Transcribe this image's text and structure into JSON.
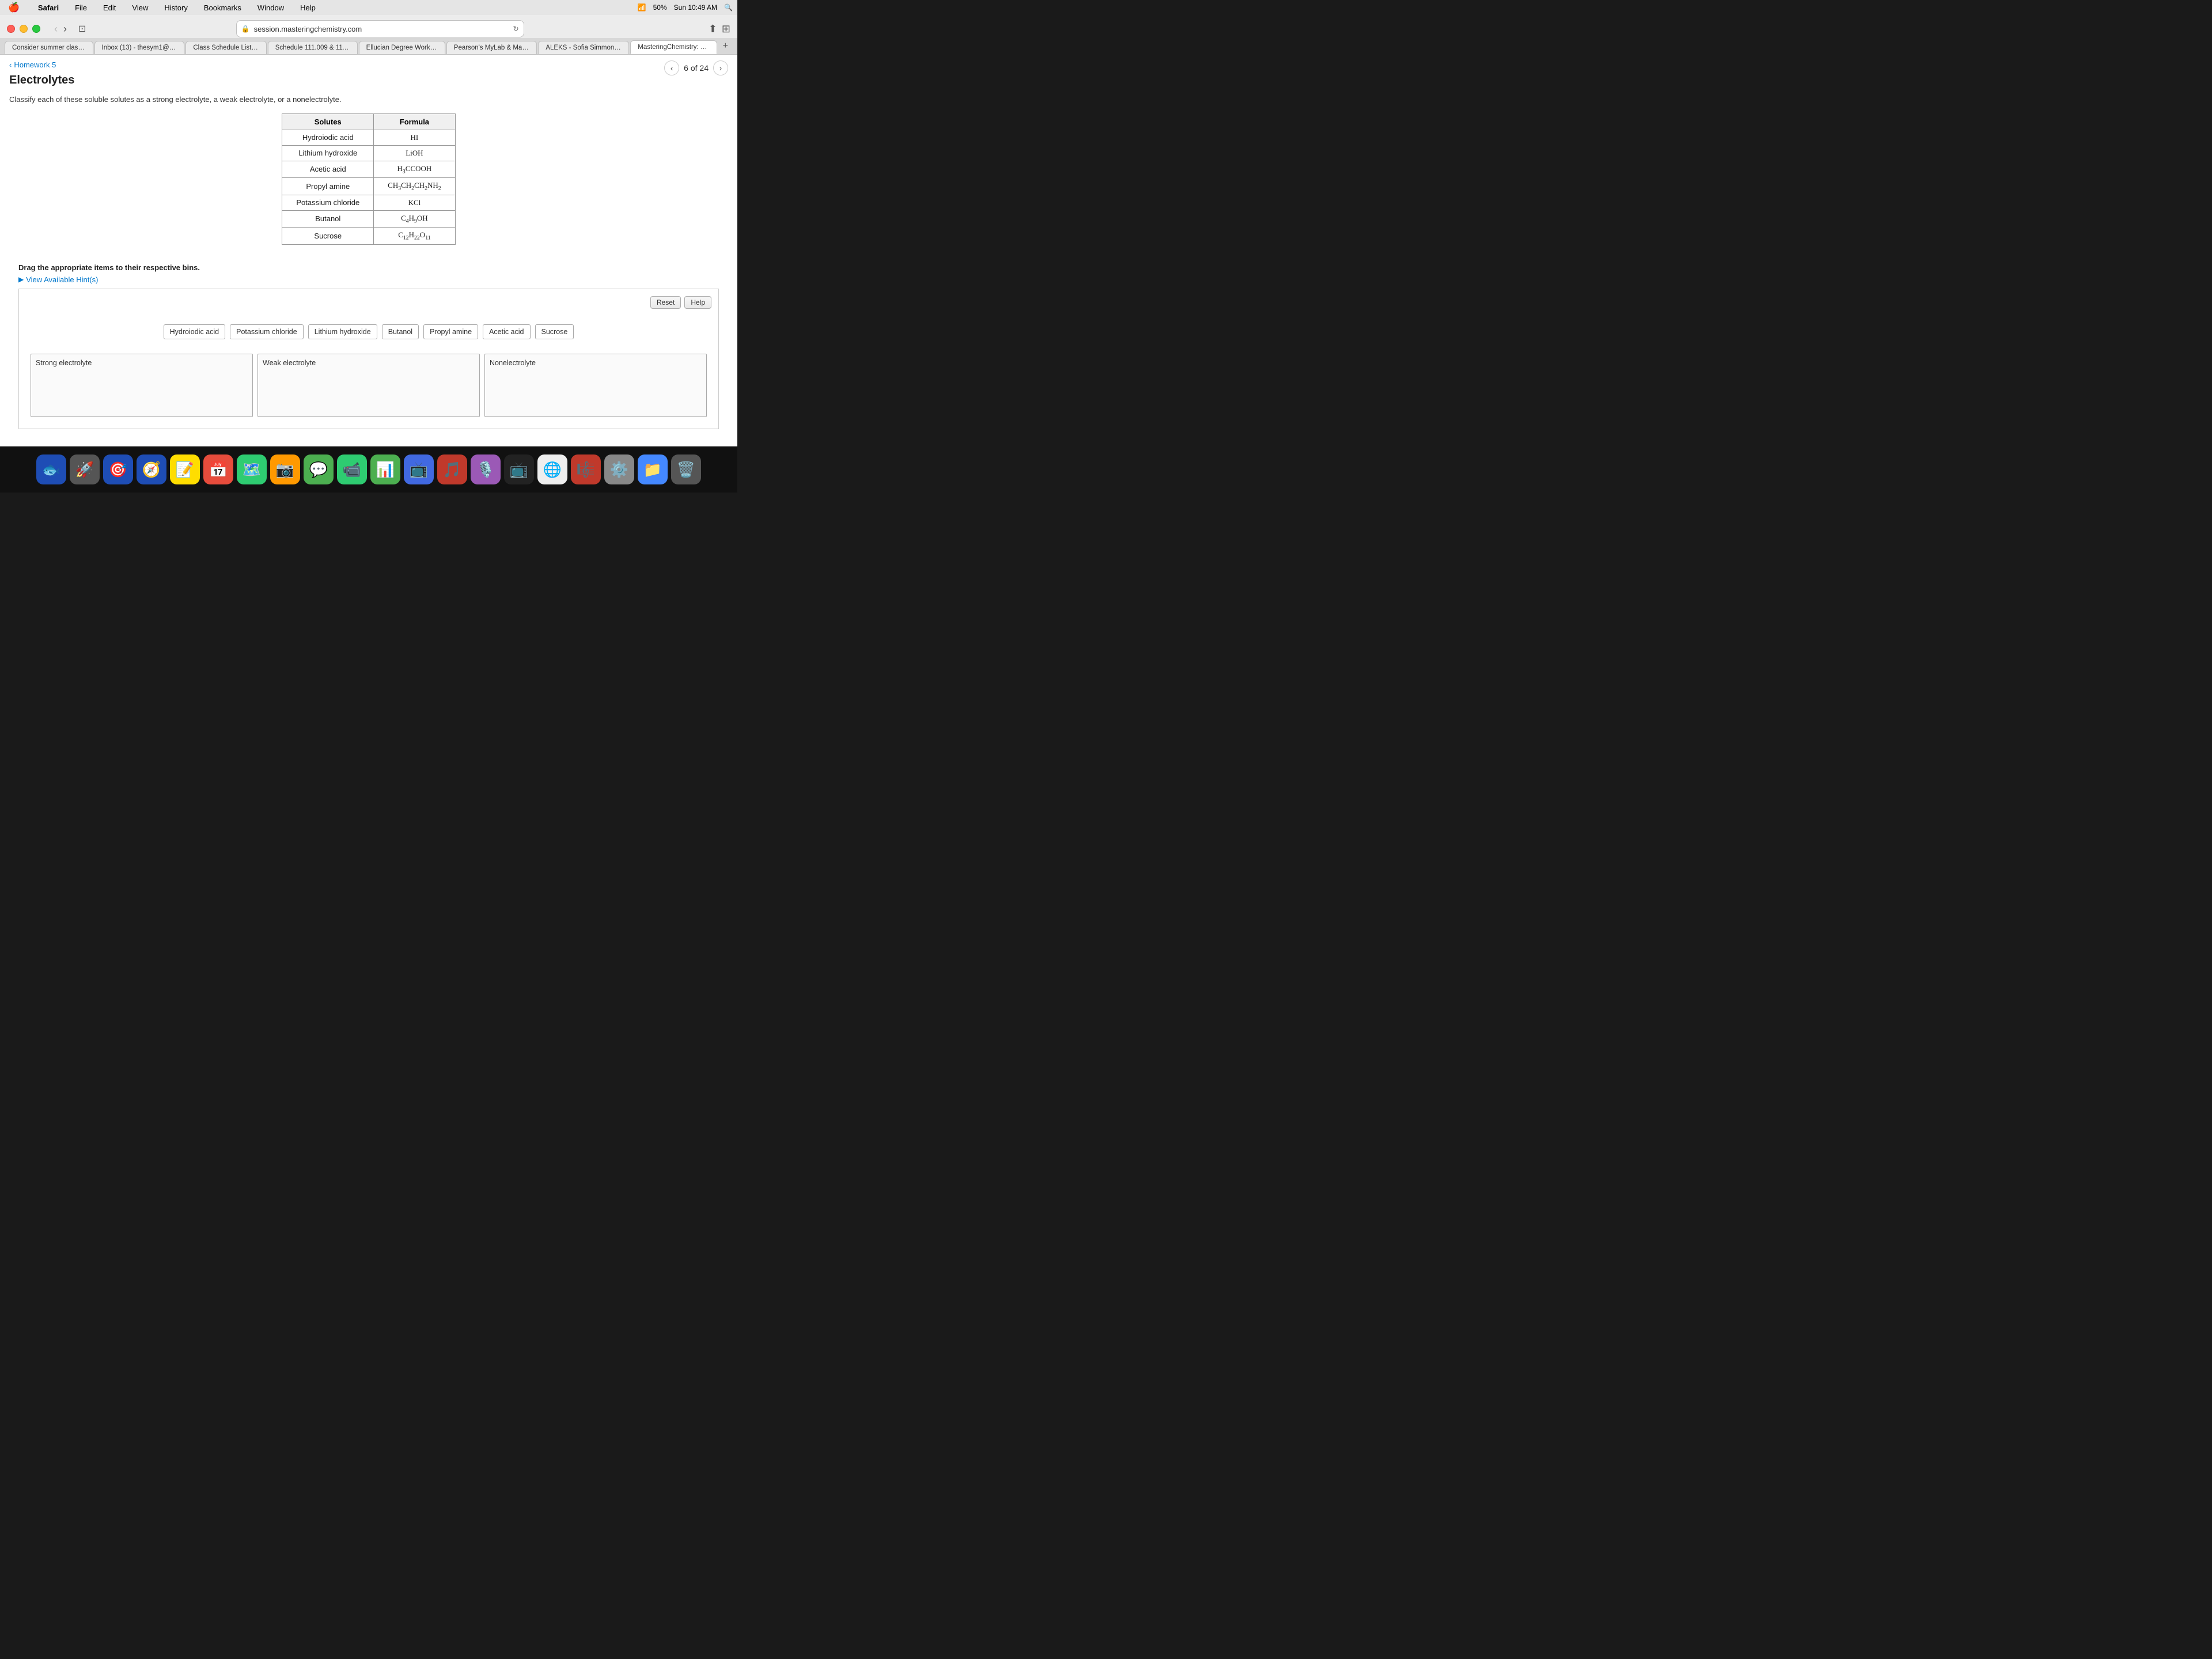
{
  "menubar": {
    "apple": "🍎",
    "items": [
      "Safari",
      "File",
      "Edit",
      "View",
      "History",
      "Bookmarks",
      "Window",
      "Help"
    ],
    "right": {
      "battery": "50%",
      "time": "Sun 10:49 AM",
      "wifi": "WiFi"
    }
  },
  "browser": {
    "address": "session.masteringchemistry.com",
    "tabs": [
      {
        "label": "Consider summer class...",
        "active": false
      },
      {
        "label": "Inbox (13) - thesym1@g...",
        "active": false
      },
      {
        "label": "Class Schedule Listing",
        "active": false
      },
      {
        "label": "Schedule 111.009 & 111...",
        "active": false
      },
      {
        "label": "Ellucian Degree Works...",
        "active": false
      },
      {
        "label": "Pearson's MyLab & Mas...",
        "active": false
      },
      {
        "label": "ALEKS - Sofia Simmons...",
        "active": false
      },
      {
        "label": "MasteringChemistry: H...",
        "active": true
      }
    ]
  },
  "page": {
    "breadcrumb_arrow": "‹",
    "breadcrumb_label": "Homework 5",
    "title": "Electrolytes",
    "pagination": {
      "current": "6",
      "total": "24",
      "label": "6 of 24"
    }
  },
  "problem": {
    "instruction": "Classify each of these soluble solutes as a strong electrolyte, a weak electrolyte, or a nonelectrolyte.",
    "table": {
      "headers": [
        "Solutes",
        "Formula"
      ],
      "rows": [
        {
          "solute": "Hydroiodic acid",
          "formula_html": "HI"
        },
        {
          "solute": "Lithium hydroxide",
          "formula_html": "LiOH"
        },
        {
          "solute": "Acetic acid",
          "formula_html": "H₃CCOOH"
        },
        {
          "solute": "Propyl amine",
          "formula_html": "CH₃CH₂CH₂NH₂"
        },
        {
          "solute": "Potassium chloride",
          "formula_html": "KCl"
        },
        {
          "solute": "Butanol",
          "formula_html": "C₄H₉OH"
        },
        {
          "solute": "Sucrose",
          "formula_html": "C₁₂H₂₂O₁₁"
        }
      ]
    },
    "drag_instruction": "Drag the appropriate items to their respective bins.",
    "hint_label": "View Available Hint(s)",
    "buttons": {
      "reset": "Reset",
      "help": "Help"
    },
    "items": [
      "Hydroiodic acid",
      "Potassium chloride",
      "Lithium hydroxide",
      "Butanol",
      "Propyl amine",
      "Acetic acid",
      "Sucrose"
    ],
    "drop_zones": [
      {
        "label": "Strong electrolyte"
      },
      {
        "label": "Weak electrolyte"
      },
      {
        "label": "Nonelectrolyte"
      }
    ]
  },
  "dock": {
    "icons": [
      {
        "name": "finder",
        "symbol": "🔵",
        "color": "#4488ff"
      },
      {
        "name": "launchpad",
        "symbol": "🚀",
        "color": "#ff6600"
      },
      {
        "name": "safari",
        "symbol": "🧭",
        "color": "#4488ff"
      },
      {
        "name": "mail",
        "symbol": "✉️",
        "color": "#4488ff"
      },
      {
        "name": "photos",
        "symbol": "📷",
        "color": "#ff9900"
      },
      {
        "name": "messages",
        "symbol": "💬",
        "color": "#4caf50"
      },
      {
        "name": "calendar",
        "symbol": "📅",
        "color": "#e74c3c"
      },
      {
        "name": "notes",
        "symbol": "📝",
        "color": "#ffdd00"
      },
      {
        "name": "numbers",
        "symbol": "📊",
        "color": "#4caf50"
      },
      {
        "name": "keynote",
        "symbol": "🎤",
        "color": "#4169e1"
      },
      {
        "name": "music",
        "symbol": "🎵",
        "color": "#e74c3c"
      },
      {
        "name": "podcasts",
        "symbol": "🎙️",
        "color": "#9b59b6"
      },
      {
        "name": "appletv",
        "symbol": "📺",
        "color": "#333"
      },
      {
        "name": "chrome",
        "symbol": "🌐",
        "color": "#4285f4"
      },
      {
        "name": "trash",
        "symbol": "🗑️",
        "color": "#888"
      }
    ]
  }
}
